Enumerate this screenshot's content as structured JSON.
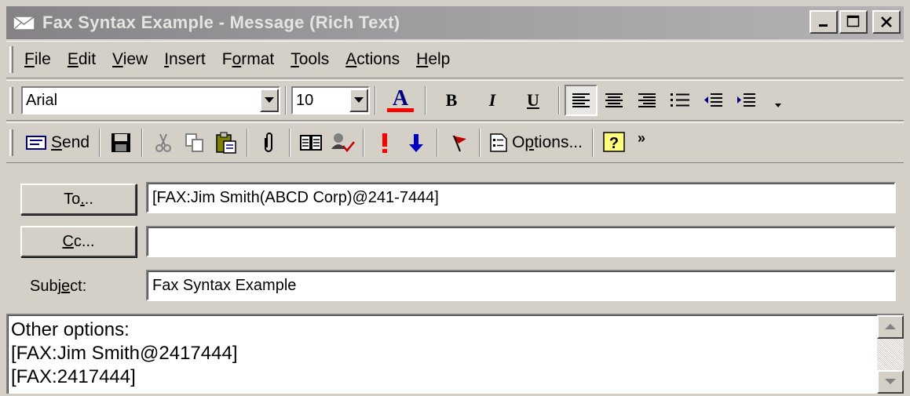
{
  "window": {
    "title": "Fax Syntax Example - Message (Rich Text)"
  },
  "menu": {
    "items": [
      {
        "label": "File",
        "mnemonic": "F"
      },
      {
        "label": "Edit",
        "mnemonic": "E"
      },
      {
        "label": "View",
        "mnemonic": "V"
      },
      {
        "label": "Insert",
        "mnemonic": "I"
      },
      {
        "label": "Format",
        "mnemonic": "o"
      },
      {
        "label": "Tools",
        "mnemonic": "T"
      },
      {
        "label": "Actions",
        "mnemonic": "A"
      },
      {
        "label": "Help",
        "mnemonic": "H"
      }
    ]
  },
  "formatting": {
    "font": "Arial",
    "size": "10",
    "bold_label": "B",
    "italic_label": "I",
    "underline_label": "U",
    "font_color_label": "A",
    "font_color": "#ff0000"
  },
  "standard": {
    "send_label": "Send",
    "options_label": "Options...",
    "more_label": "»"
  },
  "header": {
    "to_label": "To...",
    "cc_label": "Cc...",
    "subject_label": "Subject:",
    "to_value": "[FAX:Jim Smith(ABCD Corp)@241-7444]",
    "cc_value": "",
    "subject_value": "Fax Syntax Example"
  },
  "body": {
    "lines": [
      "Other options:",
      "[FAX:Jim Smith@2417444]",
      "[FAX:2417444]"
    ]
  },
  "colors": {
    "importance_high": "#ff0000",
    "importance_low": "#0000c0",
    "flag": "#c00000"
  }
}
